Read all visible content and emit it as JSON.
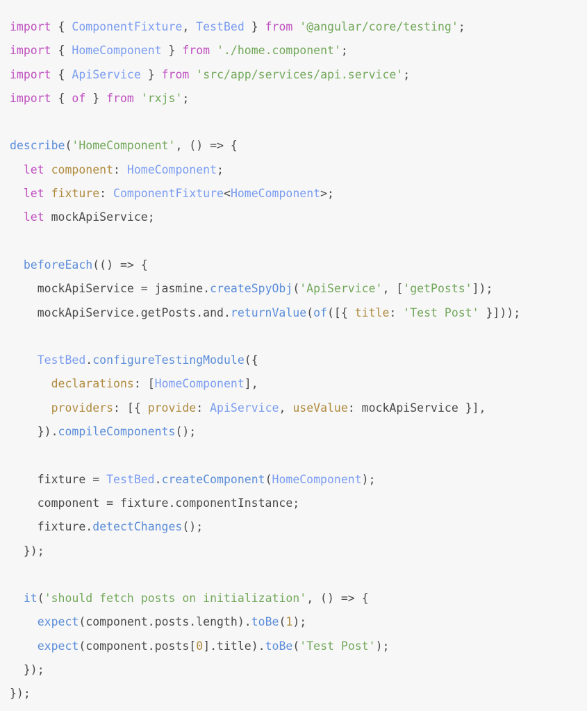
{
  "editor": {
    "language": "typescript",
    "background_color": "#f7f7f7",
    "theme_colors": {
      "keyword": "#bf4fbf",
      "class_name": "#7a9cf0",
      "function": "#5b8dd9",
      "string": "#72a85a",
      "property": "#b08b3e",
      "number": "#b08b3e",
      "plain": "#4a4a4a"
    },
    "lines": [
      {
        "n": 1,
        "text": "import { ComponentFixture, TestBed } from '@angular/core/testing';",
        "tokens": [
          {
            "t": "import",
            "c": "kw"
          },
          {
            "t": " { ",
            "c": "pl"
          },
          {
            "t": "ComponentFixture",
            "c": "cls"
          },
          {
            "t": ", ",
            "c": "pl"
          },
          {
            "t": "TestBed",
            "c": "cls"
          },
          {
            "t": " } ",
            "c": "pl"
          },
          {
            "t": "from",
            "c": "kw"
          },
          {
            "t": " ",
            "c": "pl"
          },
          {
            "t": "'@angular/core/testing'",
            "c": "str"
          },
          {
            "t": ";",
            "c": "pl"
          }
        ]
      },
      {
        "n": 2,
        "text": "import { HomeComponent } from './home.component';",
        "tokens": [
          {
            "t": "import",
            "c": "kw"
          },
          {
            "t": " { ",
            "c": "pl"
          },
          {
            "t": "HomeComponent",
            "c": "cls"
          },
          {
            "t": " } ",
            "c": "pl"
          },
          {
            "t": "from",
            "c": "kw"
          },
          {
            "t": " ",
            "c": "pl"
          },
          {
            "t": "'./home.component'",
            "c": "str"
          },
          {
            "t": ";",
            "c": "pl"
          }
        ]
      },
      {
        "n": 3,
        "text": "import { ApiService } from 'src/app/services/api.service';",
        "tokens": [
          {
            "t": "import",
            "c": "kw"
          },
          {
            "t": " { ",
            "c": "pl"
          },
          {
            "t": "ApiService",
            "c": "cls"
          },
          {
            "t": " } ",
            "c": "pl"
          },
          {
            "t": "from",
            "c": "kw"
          },
          {
            "t": " ",
            "c": "pl"
          },
          {
            "t": "'src/app/services/api.service'",
            "c": "str"
          },
          {
            "t": ";",
            "c": "pl"
          }
        ]
      },
      {
        "n": 4,
        "text": "import { of } from 'rxjs';",
        "tokens": [
          {
            "t": "import",
            "c": "kw"
          },
          {
            "t": " { ",
            "c": "pl"
          },
          {
            "t": "of",
            "c": "kw"
          },
          {
            "t": " } ",
            "c": "pl"
          },
          {
            "t": "from",
            "c": "kw"
          },
          {
            "t": " ",
            "c": "pl"
          },
          {
            "t": "'rxjs'",
            "c": "str"
          },
          {
            "t": ";",
            "c": "pl"
          }
        ]
      },
      {
        "n": 5,
        "text": "",
        "tokens": []
      },
      {
        "n": 6,
        "text": "describe('HomeComponent', () => {",
        "tokens": [
          {
            "t": "describe",
            "c": "fn"
          },
          {
            "t": "(",
            "c": "pl"
          },
          {
            "t": "'HomeComponent'",
            "c": "str"
          },
          {
            "t": ", () => {",
            "c": "pl"
          }
        ]
      },
      {
        "n": 7,
        "text": "  let component: HomeComponent;",
        "tokens": [
          {
            "t": "  ",
            "c": "pl"
          },
          {
            "t": "let",
            "c": "kw"
          },
          {
            "t": " ",
            "c": "pl"
          },
          {
            "t": "component",
            "c": "prop"
          },
          {
            "t": ": ",
            "c": "pl"
          },
          {
            "t": "HomeComponent",
            "c": "cls"
          },
          {
            "t": ";",
            "c": "pl"
          }
        ]
      },
      {
        "n": 8,
        "text": "  let fixture: ComponentFixture<HomeComponent>;",
        "tokens": [
          {
            "t": "  ",
            "c": "pl"
          },
          {
            "t": "let",
            "c": "kw"
          },
          {
            "t": " ",
            "c": "pl"
          },
          {
            "t": "fixture",
            "c": "prop"
          },
          {
            "t": ": ",
            "c": "pl"
          },
          {
            "t": "ComponentFixture",
            "c": "cls"
          },
          {
            "t": "<",
            "c": "pl"
          },
          {
            "t": "HomeComponent",
            "c": "cls"
          },
          {
            "t": ">;",
            "c": "pl"
          }
        ]
      },
      {
        "n": 9,
        "text": "  let mockApiService;",
        "tokens": [
          {
            "t": "  ",
            "c": "pl"
          },
          {
            "t": "let",
            "c": "kw"
          },
          {
            "t": " mockApiService;",
            "c": "pl"
          }
        ]
      },
      {
        "n": 10,
        "text": "",
        "tokens": []
      },
      {
        "n": 11,
        "text": "  beforeEach(() => {",
        "tokens": [
          {
            "t": "  ",
            "c": "pl"
          },
          {
            "t": "beforeEach",
            "c": "fn"
          },
          {
            "t": "(() => {",
            "c": "pl"
          }
        ]
      },
      {
        "n": 12,
        "text": "    mockApiService = jasmine.createSpyObj('ApiService', ['getPosts']);",
        "tokens": [
          {
            "t": "    mockApiService = jasmine.",
            "c": "pl"
          },
          {
            "t": "createSpyObj",
            "c": "fn"
          },
          {
            "t": "(",
            "c": "pl"
          },
          {
            "t": "'ApiService'",
            "c": "str"
          },
          {
            "t": ", [",
            "c": "pl"
          },
          {
            "t": "'getPosts'",
            "c": "str"
          },
          {
            "t": "]);",
            "c": "pl"
          }
        ]
      },
      {
        "n": 13,
        "text": "    mockApiService.getPosts.and.returnValue(of([{ title: 'Test Post' }]));",
        "tokens": [
          {
            "t": "    mockApiService.getPosts.and.",
            "c": "pl"
          },
          {
            "t": "returnValue",
            "c": "fn"
          },
          {
            "t": "(",
            "c": "pl"
          },
          {
            "t": "of",
            "c": "fn"
          },
          {
            "t": "([{ ",
            "c": "pl"
          },
          {
            "t": "title",
            "c": "prop"
          },
          {
            "t": ": ",
            "c": "pl"
          },
          {
            "t": "'Test Post'",
            "c": "str"
          },
          {
            "t": " }]));",
            "c": "pl"
          }
        ]
      },
      {
        "n": 14,
        "text": "",
        "tokens": []
      },
      {
        "n": 15,
        "text": "    TestBed.configureTestingModule({",
        "tokens": [
          {
            "t": "    ",
            "c": "pl"
          },
          {
            "t": "TestBed",
            "c": "cls"
          },
          {
            "t": ".",
            "c": "pl"
          },
          {
            "t": "configureTestingModule",
            "c": "fn"
          },
          {
            "t": "({",
            "c": "pl"
          }
        ]
      },
      {
        "n": 16,
        "text": "      declarations: [HomeComponent],",
        "tokens": [
          {
            "t": "      ",
            "c": "pl"
          },
          {
            "t": "declarations",
            "c": "prop"
          },
          {
            "t": ": [",
            "c": "pl"
          },
          {
            "t": "HomeComponent",
            "c": "cls"
          },
          {
            "t": "],",
            "c": "pl"
          }
        ]
      },
      {
        "n": 17,
        "text": "      providers: [{ provide: ApiService, useValue: mockApiService }],",
        "tokens": [
          {
            "t": "      ",
            "c": "pl"
          },
          {
            "t": "providers",
            "c": "prop"
          },
          {
            "t": ": [{ ",
            "c": "pl"
          },
          {
            "t": "provide",
            "c": "prop"
          },
          {
            "t": ": ",
            "c": "pl"
          },
          {
            "t": "ApiService",
            "c": "cls"
          },
          {
            "t": ", ",
            "c": "pl"
          },
          {
            "t": "useValue",
            "c": "prop"
          },
          {
            "t": ": mockApiService }],",
            "c": "pl"
          }
        ]
      },
      {
        "n": 18,
        "text": "    }).compileComponents();",
        "tokens": [
          {
            "t": "    }).",
            "c": "pl"
          },
          {
            "t": "compileComponents",
            "c": "fn"
          },
          {
            "t": "();",
            "c": "pl"
          }
        ]
      },
      {
        "n": 19,
        "text": "",
        "tokens": []
      },
      {
        "n": 20,
        "text": "    fixture = TestBed.createComponent(HomeComponent);",
        "tokens": [
          {
            "t": "    fixture = ",
            "c": "pl"
          },
          {
            "t": "TestBed",
            "c": "cls"
          },
          {
            "t": ".",
            "c": "pl"
          },
          {
            "t": "createComponent",
            "c": "fn"
          },
          {
            "t": "(",
            "c": "pl"
          },
          {
            "t": "HomeComponent",
            "c": "cls"
          },
          {
            "t": ");",
            "c": "pl"
          }
        ]
      },
      {
        "n": 21,
        "text": "    component = fixture.componentInstance;",
        "tokens": [
          {
            "t": "    component = fixture.componentInstance;",
            "c": "pl"
          }
        ]
      },
      {
        "n": 22,
        "text": "    fixture.detectChanges();",
        "tokens": [
          {
            "t": "    fixture.",
            "c": "pl"
          },
          {
            "t": "detectChanges",
            "c": "fn"
          },
          {
            "t": "();",
            "c": "pl"
          }
        ]
      },
      {
        "n": 23,
        "text": "  });",
        "tokens": [
          {
            "t": "  });",
            "c": "pl"
          }
        ]
      },
      {
        "n": 24,
        "text": "",
        "tokens": []
      },
      {
        "n": 25,
        "text": "  it('should fetch posts on initialization', () => {",
        "tokens": [
          {
            "t": "  ",
            "c": "pl"
          },
          {
            "t": "it",
            "c": "fn"
          },
          {
            "t": "(",
            "c": "pl"
          },
          {
            "t": "'should fetch posts on initialization'",
            "c": "str"
          },
          {
            "t": ", () => {",
            "c": "pl"
          }
        ]
      },
      {
        "n": 26,
        "text": "    expect(component.posts.length).toBe(1);",
        "tokens": [
          {
            "t": "    ",
            "c": "pl"
          },
          {
            "t": "expect",
            "c": "fn"
          },
          {
            "t": "(component.posts.length).",
            "c": "pl"
          },
          {
            "t": "toBe",
            "c": "fn"
          },
          {
            "t": "(",
            "c": "pl"
          },
          {
            "t": "1",
            "c": "num"
          },
          {
            "t": ");",
            "c": "pl"
          }
        ]
      },
      {
        "n": 27,
        "text": "    expect(component.posts[0].title).toBe('Test Post');",
        "tokens": [
          {
            "t": "    ",
            "c": "pl"
          },
          {
            "t": "expect",
            "c": "fn"
          },
          {
            "t": "(component.posts[",
            "c": "pl"
          },
          {
            "t": "0",
            "c": "num"
          },
          {
            "t": "].title).",
            "c": "pl"
          },
          {
            "t": "toBe",
            "c": "fn"
          },
          {
            "t": "(",
            "c": "pl"
          },
          {
            "t": "'Test Post'",
            "c": "str"
          },
          {
            "t": ");",
            "c": "pl"
          }
        ]
      },
      {
        "n": 28,
        "text": "  });",
        "tokens": [
          {
            "t": "  });",
            "c": "pl"
          }
        ]
      },
      {
        "n": 29,
        "text": "});",
        "tokens": [
          {
            "t": "});",
            "c": "pl"
          }
        ]
      }
    ]
  }
}
